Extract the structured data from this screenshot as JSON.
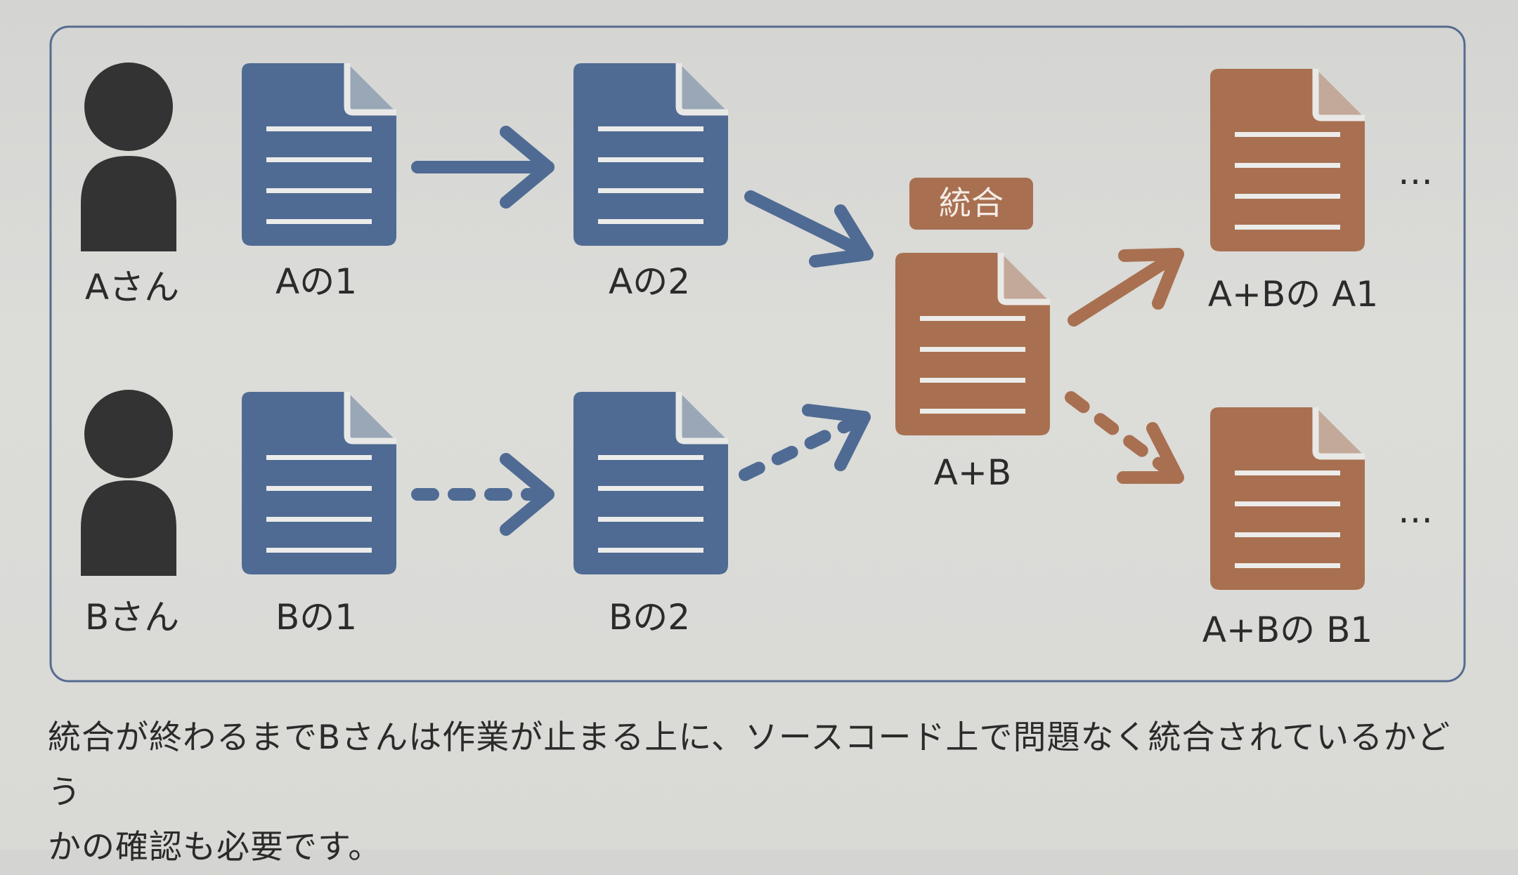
{
  "people": {
    "a": "Aさん",
    "b": "Bさん"
  },
  "docs": {
    "a1": "Aの1",
    "a2": "Aの2",
    "b1": "Bの1",
    "b2": "Bの2",
    "merged": "A+B",
    "ab_a1": "A+Bの A1",
    "ab_b1": "A+Bの B1"
  },
  "merge_badge": "統合",
  "ellipsis_top": "…",
  "ellipsis_bottom": "…",
  "colors": {
    "person": "#333333",
    "doc_blue": "#4f6b93",
    "doc_brown": "#a87050",
    "arrow_blue": "#4f6b93",
    "arrow_brown": "#a87050",
    "frame": "#566b8f"
  },
  "caption": {
    "line1": "統合が終わるまでBさんは作業が止まる上に、ソースコード上で問題なく統合されているかどう",
    "line2": "かの確認も必要です。"
  }
}
